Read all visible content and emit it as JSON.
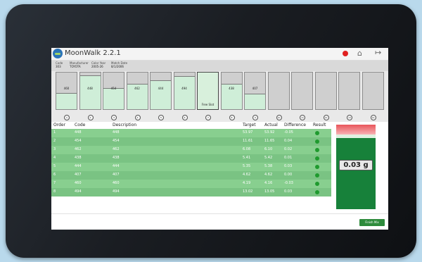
{
  "app": {
    "title": "MoonWalk 2.2.1"
  },
  "header": {
    "info": [
      {
        "label": "Code",
        "value": "303"
      },
      {
        "label": "Manufacturer",
        "value": "TOYOTA"
      },
      {
        "label": "Color Year",
        "value": "2005-26"
      },
      {
        "label": "Match Date",
        "value": "8/1/2006"
      }
    ]
  },
  "containers": [
    {
      "code": "460",
      "fill": 0.45
    },
    {
      "code": "448",
      "fill": 0.92
    },
    {
      "code": "454",
      "fill": 0.57
    },
    {
      "code": "462",
      "fill": 0.7
    },
    {
      "code": "444",
      "fill": 0.78
    },
    {
      "code": "494",
      "fill": 0.9
    },
    {
      "code": "Free Slot",
      "fill": 1.0
    },
    {
      "code": "438",
      "fill": 0.7
    },
    {
      "code": "407",
      "fill": 0.42
    },
    {
      "code": "",
      "fill": 0
    },
    {
      "code": "",
      "fill": 0
    },
    {
      "code": "",
      "fill": 0
    },
    {
      "code": "",
      "fill": 0
    },
    {
      "code": "",
      "fill": 0
    }
  ],
  "container_numbers": [
    "1",
    "2",
    "3",
    "4",
    "5",
    "6",
    "7",
    "8",
    "9",
    "10",
    "11",
    "12",
    "13",
    "14"
  ],
  "table": {
    "headers": {
      "order": "Order",
      "code": "Code",
      "description": "Description",
      "target": "Target",
      "actual": "Actual",
      "difference": "Difference",
      "result": "Result"
    },
    "rows": [
      {
        "order": "1",
        "code": "448",
        "description": "448",
        "target": "53.97",
        "actual": "53.92",
        "difference": "-0.05",
        "result": "ok"
      },
      {
        "order": "2",
        "code": "454",
        "description": "454",
        "target": "11.61",
        "actual": "11.65",
        "difference": "0.04",
        "result": "ok"
      },
      {
        "order": "3",
        "code": "462",
        "description": "462",
        "target": "6.08",
        "actual": "6.10",
        "difference": "0.02",
        "result": "ok"
      },
      {
        "order": "4",
        "code": "438",
        "description": "438",
        "target": "5.41",
        "actual": "5.42",
        "difference": "0.01",
        "result": "ok"
      },
      {
        "order": "5",
        "code": "444",
        "description": "444",
        "target": "5.35",
        "actual": "5.38",
        "difference": "0.03",
        "result": "ok"
      },
      {
        "order": "6",
        "code": "407",
        "description": "407",
        "target": "4.62",
        "actual": "4.62",
        "difference": "0.00",
        "result": "ok"
      },
      {
        "order": "7",
        "code": "460",
        "description": "460",
        "target": "4.19",
        "actual": "4.16",
        "difference": "-0.03",
        "result": "ok"
      },
      {
        "order": "8",
        "code": "494",
        "description": "494",
        "target": "13.02",
        "actual": "13.05",
        "difference": "0.03",
        "result": "ok"
      }
    ]
  },
  "gauge": {
    "value": "0.03 g"
  },
  "footer": {
    "button_label": "Finish Mix"
  },
  "colors": {
    "accent": "#2e8b3c",
    "row": "#88cf8f",
    "status_ok": "#1f9a2e",
    "alert": "#e02020"
  },
  "icons": {
    "status": "status-dot",
    "home": "home-icon",
    "logout": "logout-icon",
    "logo": "logo-icon"
  }
}
